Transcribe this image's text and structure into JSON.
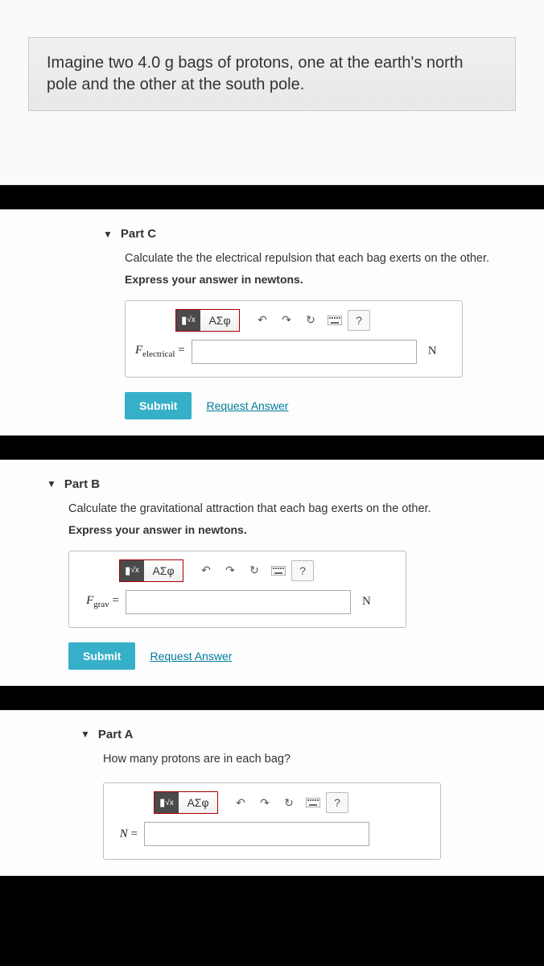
{
  "problem": {
    "statement": "Imagine two 4.0 g bags of protons, one at the earth's north pole and the other at the south pole."
  },
  "toolbar": {
    "templates_label": "▮",
    "math_label": "√x",
    "symbols_label": "ΑΣφ",
    "undo": "↶",
    "redo": "↷",
    "reset": "↻",
    "help": "?"
  },
  "partC": {
    "title": "Part C",
    "prompt": "Calculate the the electrical repulsion that each bag exerts on the other.",
    "instruction": "Express your answer in newtons.",
    "label_prefix": "F",
    "label_sub": "electrical",
    "equals": "=",
    "value": "",
    "unit": "N",
    "submit": "Submit",
    "request": "Request Answer"
  },
  "partB": {
    "title": "Part B",
    "prompt": "Calculate the gravitational attraction that each bag exerts on the other.",
    "instruction": "Express your answer in newtons.",
    "label_prefix": "F",
    "label_sub": "grav",
    "equals": "=",
    "value": "",
    "unit": "N",
    "submit": "Submit",
    "request": "Request Answer"
  },
  "partA": {
    "title": "Part A",
    "prompt": "How many protons are in each bag?",
    "label_prefix": "N",
    "equals": "=",
    "value": ""
  }
}
